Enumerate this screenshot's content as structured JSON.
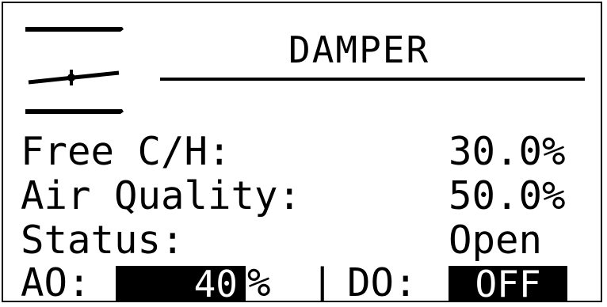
{
  "screen": {
    "title": "DAMPER",
    "icon": "damper-icon",
    "rows": [
      {
        "label": "Free C/H:",
        "value": "30.0%"
      },
      {
        "label": "Air Quality:",
        "value": "50.0%"
      },
      {
        "label": "Status:",
        "value": "Open"
      }
    ],
    "ao": {
      "label": "AO:",
      "value": "40",
      "unit": "%"
    },
    "separator": "|",
    "do": {
      "label": "DO:",
      "value": "OFF"
    }
  }
}
